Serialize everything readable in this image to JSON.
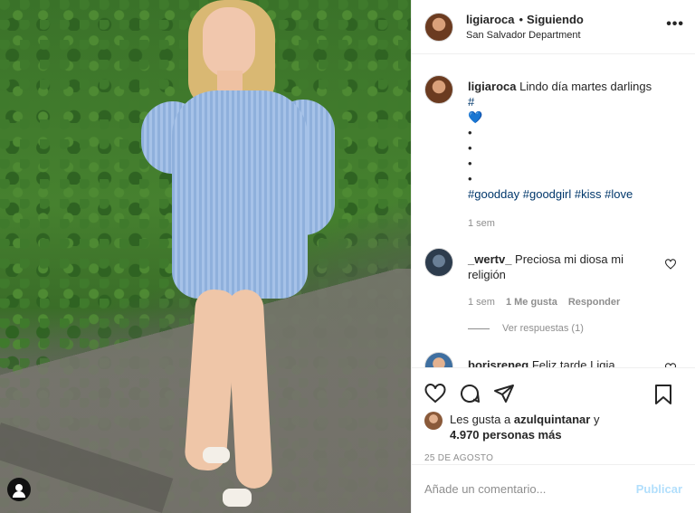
{
  "header": {
    "username": "ligiaroca",
    "separator": "•",
    "follow_state": "Siguiendo",
    "location": "San Salvador Department",
    "more_icon": "more-horizontal-icon"
  },
  "caption": {
    "username": "ligiaroca",
    "text": "Lindo día martes darlings",
    "hash": "#",
    "emoji": "💙",
    "dots": [
      "•",
      "•",
      "•",
      "•"
    ],
    "hashtags": [
      "#goodday",
      "#goodgirl",
      "#kiss",
      "#love"
    ],
    "time": "1 sem"
  },
  "comments": [
    {
      "username": "_wertv_",
      "text": "Preciosa mi diosa mi religión",
      "time": "1 sem",
      "likes": "1 Me gusta",
      "reply": "Responder"
    },
    {
      "username": "borisreneg",
      "text": "Feliz tarde Ligia"
    }
  ],
  "replies_label": "Ver respuestas (1)",
  "actions": {
    "icons": [
      "heart-icon",
      "comment-icon",
      "share-icon",
      "bookmark-icon"
    ]
  },
  "likes": {
    "prefix": "Les gusta a",
    "user": "azulquintanar",
    "and": "y",
    "others": "4.970 personas más"
  },
  "date": "25 DE AGOSTO",
  "add_comment": {
    "placeholder": "Añade un comentario...",
    "button": "Publicar"
  },
  "colors": {
    "link": "#00376b",
    "muted": "#8e8e8e",
    "publish_disabled": "#b2dffc"
  }
}
